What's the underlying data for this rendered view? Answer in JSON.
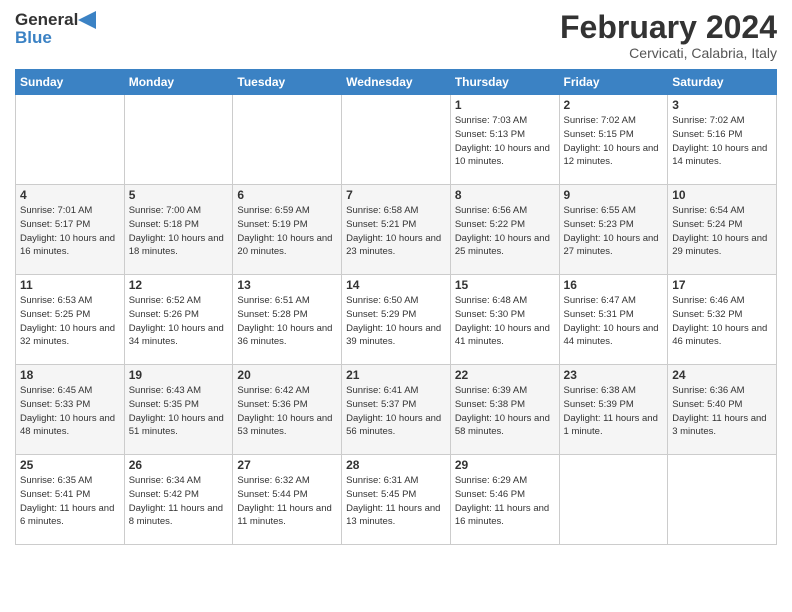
{
  "header": {
    "logo_general": "General",
    "logo_blue": "Blue",
    "title": "February 2024",
    "subtitle": "Cervicati, Calabria, Italy"
  },
  "weekdays": [
    "Sunday",
    "Monday",
    "Tuesday",
    "Wednesday",
    "Thursday",
    "Friday",
    "Saturday"
  ],
  "weeks": [
    [
      {
        "day": "",
        "info": ""
      },
      {
        "day": "",
        "info": ""
      },
      {
        "day": "",
        "info": ""
      },
      {
        "day": "",
        "info": ""
      },
      {
        "day": "1",
        "info": "Sunrise: 7:03 AM\nSunset: 5:13 PM\nDaylight: 10 hours\nand 10 minutes."
      },
      {
        "day": "2",
        "info": "Sunrise: 7:02 AM\nSunset: 5:15 PM\nDaylight: 10 hours\nand 12 minutes."
      },
      {
        "day": "3",
        "info": "Sunrise: 7:02 AM\nSunset: 5:16 PM\nDaylight: 10 hours\nand 14 minutes."
      }
    ],
    [
      {
        "day": "4",
        "info": "Sunrise: 7:01 AM\nSunset: 5:17 PM\nDaylight: 10 hours\nand 16 minutes."
      },
      {
        "day": "5",
        "info": "Sunrise: 7:00 AM\nSunset: 5:18 PM\nDaylight: 10 hours\nand 18 minutes."
      },
      {
        "day": "6",
        "info": "Sunrise: 6:59 AM\nSunset: 5:19 PM\nDaylight: 10 hours\nand 20 minutes."
      },
      {
        "day": "7",
        "info": "Sunrise: 6:58 AM\nSunset: 5:21 PM\nDaylight: 10 hours\nand 23 minutes."
      },
      {
        "day": "8",
        "info": "Sunrise: 6:56 AM\nSunset: 5:22 PM\nDaylight: 10 hours\nand 25 minutes."
      },
      {
        "day": "9",
        "info": "Sunrise: 6:55 AM\nSunset: 5:23 PM\nDaylight: 10 hours\nand 27 minutes."
      },
      {
        "day": "10",
        "info": "Sunrise: 6:54 AM\nSunset: 5:24 PM\nDaylight: 10 hours\nand 29 minutes."
      }
    ],
    [
      {
        "day": "11",
        "info": "Sunrise: 6:53 AM\nSunset: 5:25 PM\nDaylight: 10 hours\nand 32 minutes."
      },
      {
        "day": "12",
        "info": "Sunrise: 6:52 AM\nSunset: 5:26 PM\nDaylight: 10 hours\nand 34 minutes."
      },
      {
        "day": "13",
        "info": "Sunrise: 6:51 AM\nSunset: 5:28 PM\nDaylight: 10 hours\nand 36 minutes."
      },
      {
        "day": "14",
        "info": "Sunrise: 6:50 AM\nSunset: 5:29 PM\nDaylight: 10 hours\nand 39 minutes."
      },
      {
        "day": "15",
        "info": "Sunrise: 6:48 AM\nSunset: 5:30 PM\nDaylight: 10 hours\nand 41 minutes."
      },
      {
        "day": "16",
        "info": "Sunrise: 6:47 AM\nSunset: 5:31 PM\nDaylight: 10 hours\nand 44 minutes."
      },
      {
        "day": "17",
        "info": "Sunrise: 6:46 AM\nSunset: 5:32 PM\nDaylight: 10 hours\nand 46 minutes."
      }
    ],
    [
      {
        "day": "18",
        "info": "Sunrise: 6:45 AM\nSunset: 5:33 PM\nDaylight: 10 hours\nand 48 minutes."
      },
      {
        "day": "19",
        "info": "Sunrise: 6:43 AM\nSunset: 5:35 PM\nDaylight: 10 hours\nand 51 minutes."
      },
      {
        "day": "20",
        "info": "Sunrise: 6:42 AM\nSunset: 5:36 PM\nDaylight: 10 hours\nand 53 minutes."
      },
      {
        "day": "21",
        "info": "Sunrise: 6:41 AM\nSunset: 5:37 PM\nDaylight: 10 hours\nand 56 minutes."
      },
      {
        "day": "22",
        "info": "Sunrise: 6:39 AM\nSunset: 5:38 PM\nDaylight: 10 hours\nand 58 minutes."
      },
      {
        "day": "23",
        "info": "Sunrise: 6:38 AM\nSunset: 5:39 PM\nDaylight: 11 hours\nand 1 minute."
      },
      {
        "day": "24",
        "info": "Sunrise: 6:36 AM\nSunset: 5:40 PM\nDaylight: 11 hours\nand 3 minutes."
      }
    ],
    [
      {
        "day": "25",
        "info": "Sunrise: 6:35 AM\nSunset: 5:41 PM\nDaylight: 11 hours\nand 6 minutes."
      },
      {
        "day": "26",
        "info": "Sunrise: 6:34 AM\nSunset: 5:42 PM\nDaylight: 11 hours\nand 8 minutes."
      },
      {
        "day": "27",
        "info": "Sunrise: 6:32 AM\nSunset: 5:44 PM\nDaylight: 11 hours\nand 11 minutes."
      },
      {
        "day": "28",
        "info": "Sunrise: 6:31 AM\nSunset: 5:45 PM\nDaylight: 11 hours\nand 13 minutes."
      },
      {
        "day": "29",
        "info": "Sunrise: 6:29 AM\nSunset: 5:46 PM\nDaylight: 11 hours\nand 16 minutes."
      },
      {
        "day": "",
        "info": ""
      },
      {
        "day": "",
        "info": ""
      }
    ]
  ]
}
